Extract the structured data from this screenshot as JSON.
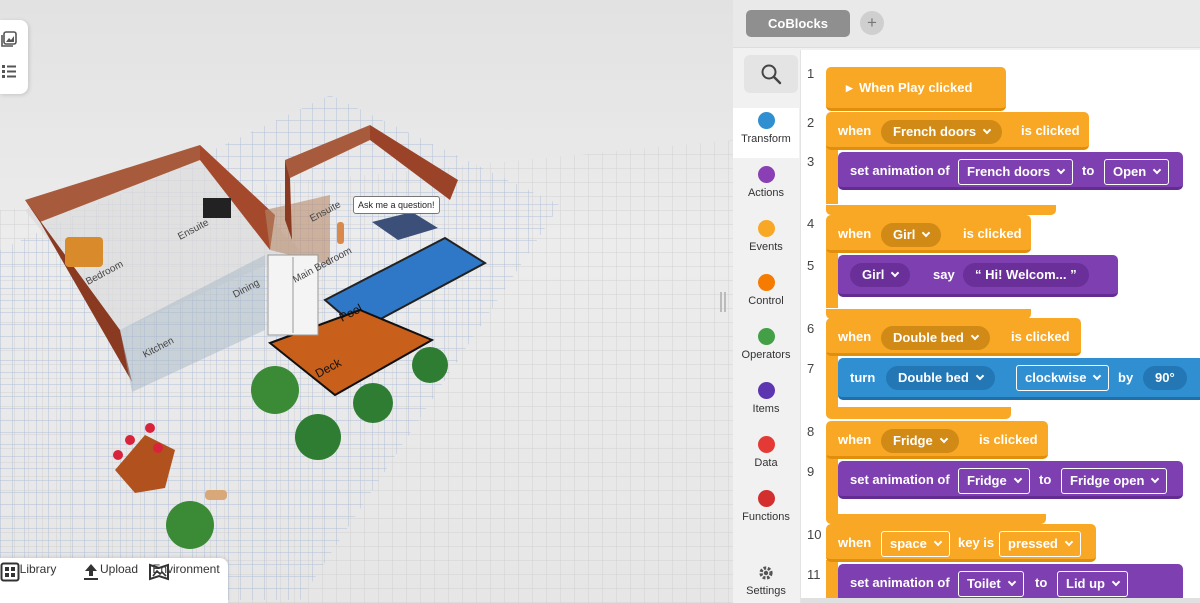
{
  "scene": {
    "speech": "Ask me a question!",
    "floor_labels": [
      "Bedroom",
      "Ensuite",
      "Ensuite",
      "Dining",
      "Main Bedroom",
      "Kitchen",
      "Pool",
      "Deck"
    ]
  },
  "bottom_bar": [
    {
      "label": "Library",
      "icon": "library-icon"
    },
    {
      "label": "Upload",
      "icon": "upload-icon"
    },
    {
      "label": "Environment",
      "icon": "environment-icon"
    }
  ],
  "editor": {
    "tab": "CoBlocks",
    "add_tab": "+",
    "categories": [
      {
        "label": "Transform",
        "color": "#2f8fd0",
        "active": true
      },
      {
        "label": "Actions",
        "color": "#8a3fb5"
      },
      {
        "label": "Events",
        "color": "#f9a825"
      },
      {
        "label": "Control",
        "color": "#f57c00"
      },
      {
        "label": "Operators",
        "color": "#43a047"
      },
      {
        "label": "Items",
        "color": "#5e35b1"
      },
      {
        "label": "Data",
        "color": "#e53935"
      },
      {
        "label": "Functions",
        "color": "#d32f2f"
      }
    ],
    "settings": "Settings",
    "lines": [
      "1",
      "2",
      "3",
      "4",
      "5",
      "6",
      "7",
      "8",
      "9",
      "10",
      "11"
    ],
    "code": {
      "play": "When Play clicked",
      "b2": {
        "when": "when",
        "item": "French doors",
        "suffix": "is clicked"
      },
      "b3": {
        "prefix": "set animation of",
        "item": "French doors",
        "to": "to",
        "value": "Open"
      },
      "b4": {
        "when": "when",
        "item": "Girl",
        "suffix": "is clicked"
      },
      "b5": {
        "item": "Girl",
        "say": "say",
        "text": "“ Hi! Welcom... ”"
      },
      "b6": {
        "when": "when",
        "item": "Double bed",
        "suffix": "is clicked"
      },
      "b7": {
        "turn": "turn",
        "item": "Double bed",
        "dir": "clockwise",
        "by": "by",
        "angle": "90°"
      },
      "b8": {
        "when": "when",
        "item": "Fridge",
        "suffix": "is clicked"
      },
      "b9": {
        "prefix": "set animation of",
        "item": "Fridge",
        "to": "to",
        "value": "Fridge open"
      },
      "b10": {
        "when": "when",
        "key": "space",
        "mid": "key is",
        "state": "pressed"
      },
      "b11": {
        "prefix": "set animation of",
        "item": "Toilet",
        "to": "to",
        "value": "Lid up"
      }
    }
  }
}
